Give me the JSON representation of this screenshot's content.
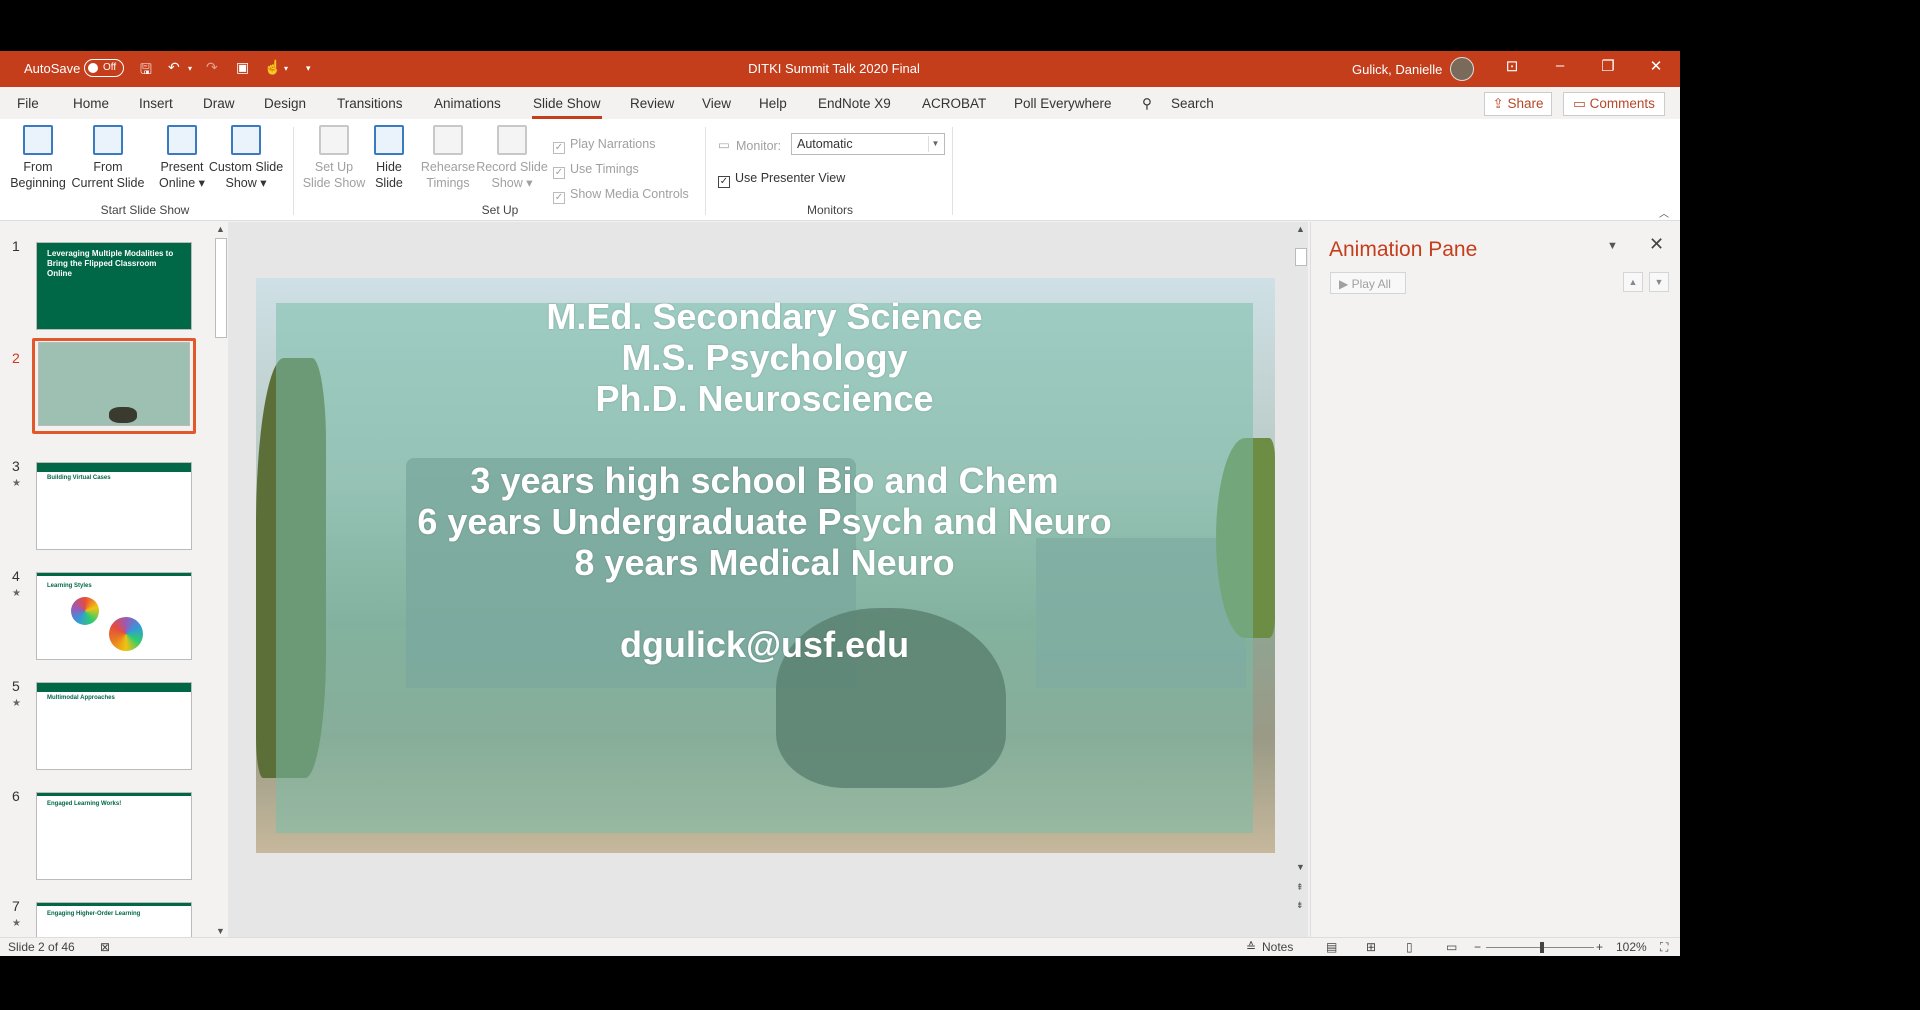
{
  "titlebar": {
    "autosave_label": "AutoSave",
    "autosave_state": "Off",
    "doc_title": "DITKI Summit Talk 2020 Final",
    "user_name": "Gulick, Danielle"
  },
  "tabs": [
    "File",
    "Home",
    "Insert",
    "Draw",
    "Design",
    "Transitions",
    "Animations",
    "Slide Show",
    "Review",
    "View",
    "Help",
    "EndNote X9",
    "ACROBAT",
    "Poll Everywhere"
  ],
  "active_tab": "Slide Show",
  "search_label": "Search",
  "share_label": "Share",
  "comments_label": "Comments",
  "ribbon": {
    "start": {
      "group_label": "Start Slide Show",
      "from_beginning": [
        "From",
        "Beginning"
      ],
      "from_current": [
        "From",
        "Current Slide"
      ],
      "present_online": [
        "Present",
        "Online ▾"
      ],
      "custom_show": [
        "Custom Slide",
        "Show ▾"
      ]
    },
    "setup": {
      "group_label": "Set Up",
      "setup_show": [
        "Set Up",
        "Slide Show"
      ],
      "hide_slide": [
        "Hide",
        "Slide"
      ],
      "rehearse": [
        "Rehearse",
        "Timings"
      ],
      "record": [
        "Record Slide",
        "Show ▾"
      ],
      "play_narrations": "Play Narrations",
      "use_timings": "Use Timings",
      "show_media_controls": "Show Media Controls"
    },
    "monitors": {
      "group_label": "Monitors",
      "monitor_label": "Monitor:",
      "monitor_value": "Automatic",
      "use_presenter_view": "Use Presenter View"
    }
  },
  "thumbnails": [
    {
      "num": "1",
      "title": "Leveraging Multiple Modalities to Bring the Flipped Classroom Online"
    },
    {
      "num": "2",
      "title": ""
    },
    {
      "num": "3",
      "title": "Building Virtual Cases"
    },
    {
      "num": "4",
      "title": "Learning Styles"
    },
    {
      "num": "5",
      "title": "Multimodal Approaches"
    },
    {
      "num": "6",
      "title": "Engaged Learning Works!"
    },
    {
      "num": "7",
      "title": "Engaging Higher-Order Learning"
    }
  ],
  "slide": {
    "line1": "M.Ed. Secondary Science",
    "line2": "M.S. Psychology",
    "line3": "Ph.D. Neuroscience",
    "line4": "3 years high school Bio and Chem",
    "line5": "6 years Undergraduate Psych and Neuro",
    "line6": "8 years Medical Neuro",
    "email": "dgulick@usf.edu"
  },
  "animation_pane": {
    "title": "Animation Pane",
    "play_all": "Play All"
  },
  "statusbar": {
    "slide_info": "Slide 2 of 46",
    "notes": "Notes",
    "zoom": "102%"
  },
  "colors": {
    "accent": "#c43e1c",
    "selection": "#e3582b",
    "usf_green": "#006747"
  }
}
